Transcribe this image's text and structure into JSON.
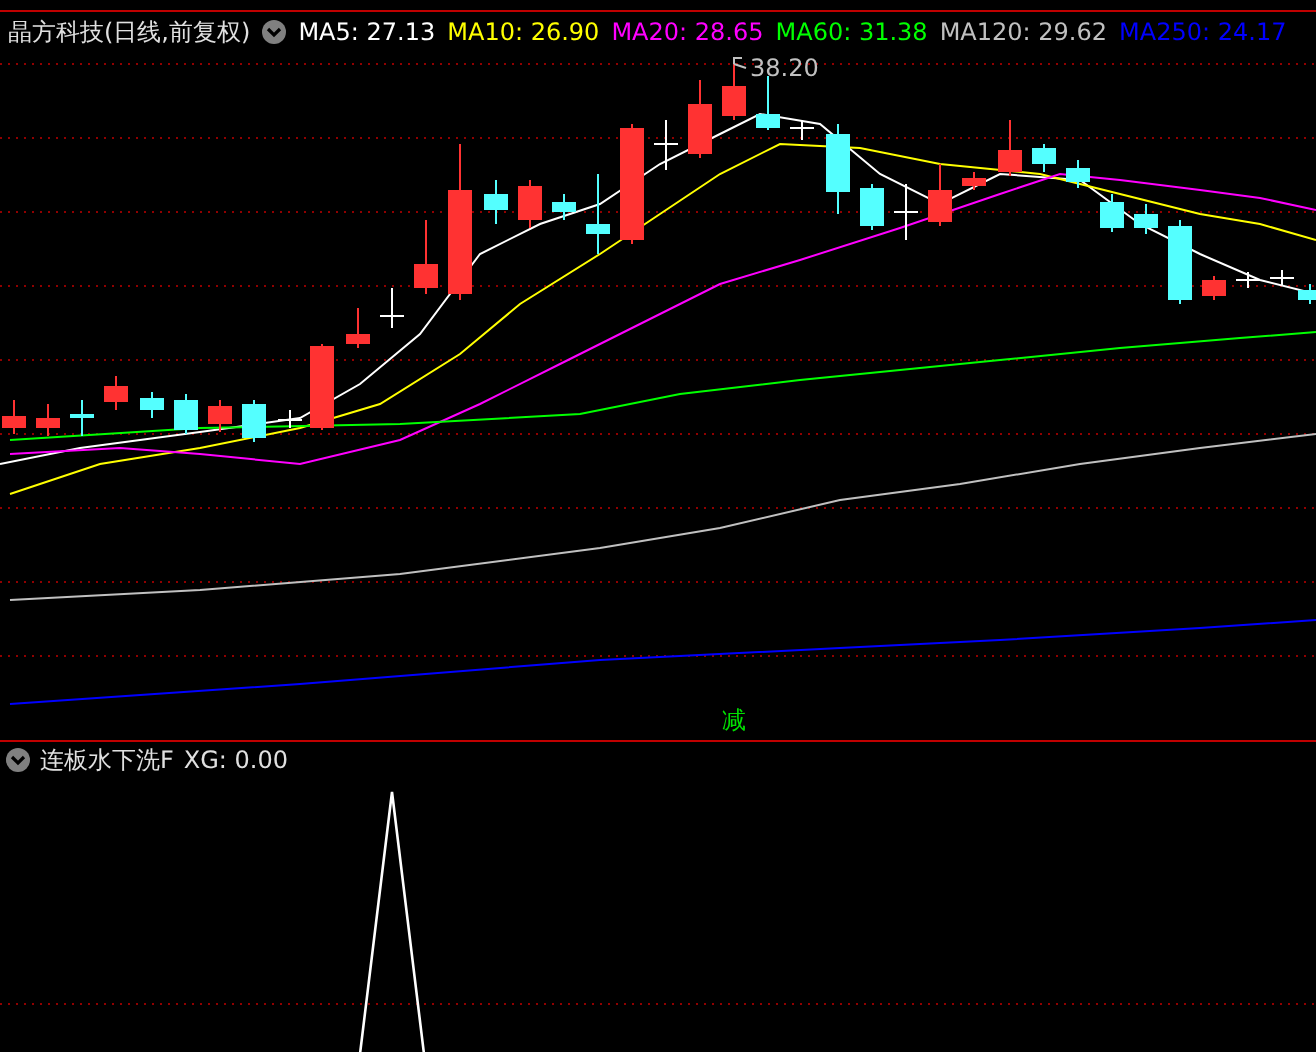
{
  "chart_header": {
    "title": "晶方科技(日线,前复权)",
    "moving_averages": [
      {
        "label": "MA5:",
        "value": "27.13",
        "color": "#ffffff"
      },
      {
        "label": "MA10:",
        "value": "26.90",
        "color": "#ffff00"
      },
      {
        "label": "MA20:",
        "value": "28.65",
        "color": "#ff00ff"
      },
      {
        "label": "MA60:",
        "value": "31.38",
        "color": "#00ff00"
      },
      {
        "label": "MA120:",
        "value": "29.62",
        "color": "#c0c0c0"
      },
      {
        "label": "MA250:",
        "value": "24.17",
        "color": "#0000ff"
      }
    ]
  },
  "price_chart": {
    "high_label": "38.20",
    "signal_label": "减"
  },
  "indicator_header": {
    "title": "连板水下洗F",
    "reading": "XG: 0.00"
  }
}
